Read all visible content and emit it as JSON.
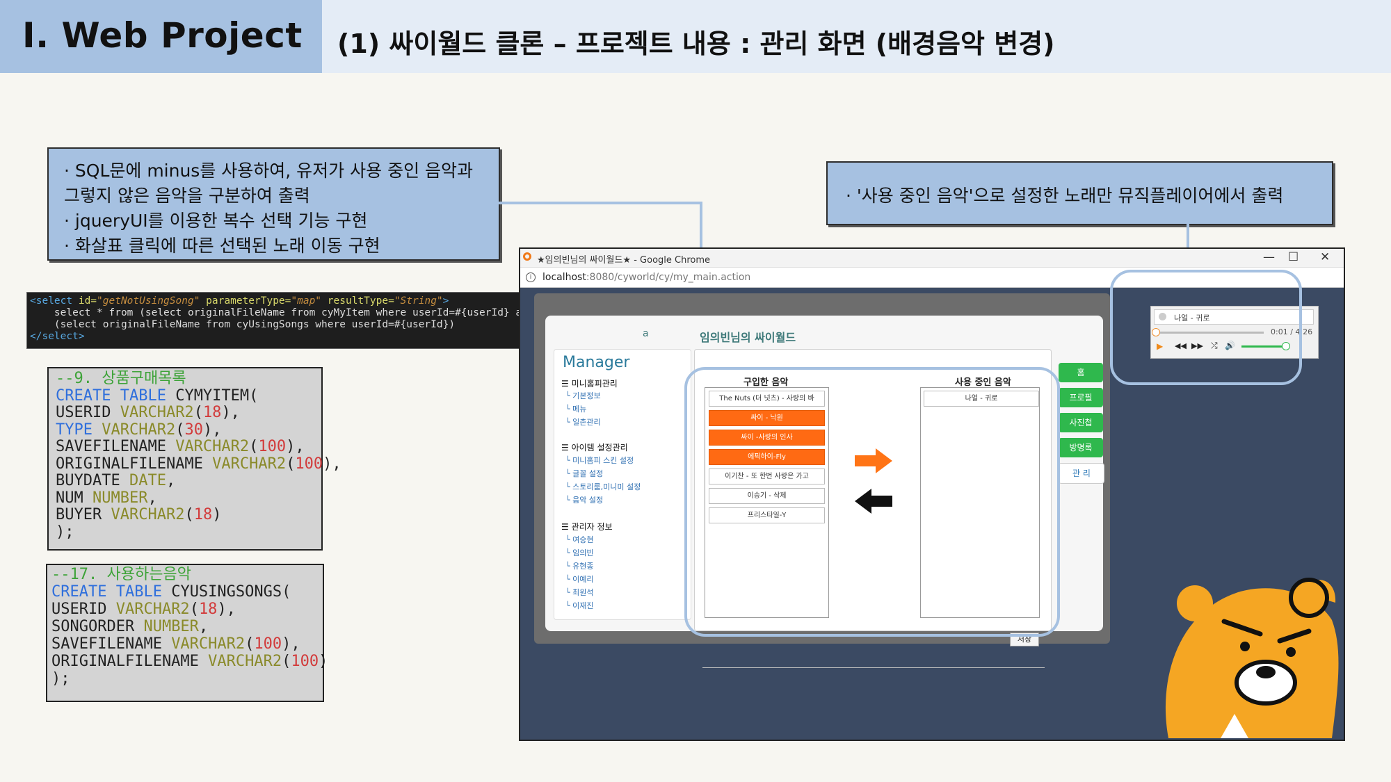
{
  "header": {
    "section": "Ⅰ. Web Project",
    "title": "(1) 싸이월드 클론 – 프로젝트 내용 : 관리 화면 (배경음악 변경)"
  },
  "notes": {
    "left": [
      "· SQL문에 minus를 사용하여, 유저가 사용 중인 음악과",
      "  그렇지 않은 음악을 구분하여 출력",
      "· jqueryUI를 이용한 복수 선택 기능 구현",
      "· 화살표 클릭에 따른 선택된 노래 이동 구현"
    ],
    "right": "· '사용 중인 음악'으로 설정한 노래만 뮤직플레이어에서 출력"
  },
  "sql_select": {
    "line1_tag_open": "<select",
    "line1_attr1": " id=",
    "line1_val1": "\"getNotUsingSong\"",
    "line1_attr2": " parameterType=",
    "line1_val2": "\"map\"",
    "line1_attr3": " resultType=",
    "line1_val3": "\"String\"",
    "line1_close": ">",
    "line2": "    select * from (select originalFileName from cyMyItem where userId=#{userId} and type = #{type}) minus",
    "line3": "    (select originalFileName from cyUsingSongs where userId=#{userId})",
    "line4": "</select>"
  },
  "code_cymyitem": {
    "comment": "--9. 상품구매목록",
    "create": "CREATE TABLE",
    "table": " CYMYITEM(",
    "cols": [
      {
        "name": "USERID ",
        "type": "VARCHAR2",
        "open": "(",
        "size": "18",
        "close": "),"
      },
      {
        "name": "TYPE ",
        "type": "VARCHAR2",
        "open": "(",
        "size": "30",
        "close": "),"
      },
      {
        "name": "SAVEFILENAME ",
        "type": "VARCHAR2",
        "open": "(",
        "size": "100",
        "close": "),"
      },
      {
        "name": "ORIGINALFILENAME ",
        "type": "VARCHAR2",
        "open": "(",
        "size": "100",
        "close": "),"
      },
      {
        "name": "BUYDATE ",
        "type": "DATE",
        "open": "",
        "size": "",
        "close": ","
      },
      {
        "name": "NUM ",
        "type": "NUMBER",
        "open": "",
        "size": "",
        "close": ","
      },
      {
        "name": "BUYER ",
        "type": "VARCHAR2",
        "open": "(",
        "size": "18",
        "close": ")"
      }
    ],
    "end": ");"
  },
  "code_cyusingsongs": {
    "comment": "--17. 사용하는음악",
    "create": "CREATE TABLE",
    "table": " CYUSINGSONGS(",
    "cols": [
      {
        "name": "USERID ",
        "type": "VARCHAR2",
        "open": "(",
        "size": "18",
        "close": "),"
      },
      {
        "name": "SONGORDER ",
        "type": "NUMBER",
        "open": "",
        "size": "",
        "close": ","
      },
      {
        "name": "SAVEFILENAME ",
        "type": "VARCHAR2",
        "open": "(",
        "size": "100",
        "close": "),"
      },
      {
        "name": "ORIGINALFILENAME ",
        "type": "VARCHAR2",
        "open": "(",
        "size": "100",
        "close": ")"
      }
    ],
    "end": ");"
  },
  "browser": {
    "title": "★임의빈님의 싸이월드★ - Google Chrome",
    "url_host": "localhost",
    "url_path": ":8080/cyworld/cy/my_main.action",
    "buttons": {
      "minimize": "—",
      "maximize": "☐",
      "close": "✕"
    }
  },
  "cy": {
    "page_title": "임의빈님의 싸이월드",
    "manager_title": "Manager",
    "menu": [
      {
        "heading": "미니홈피관리",
        "items": [
          "기본정보",
          "메뉴",
          "일촌관리"
        ]
      },
      {
        "heading": "아이템 설정관리",
        "items": [
          "미니홈피 스킨 설정",
          "글꼴 설정",
          "스토리룸,미니미 설정",
          "음악 설정"
        ]
      },
      {
        "heading": "관리자 정보",
        "items": [
          "여승현",
          "임의빈",
          "유현종",
          "이예리",
          "최원석",
          "이재진"
        ]
      }
    ],
    "purchased_label": "구입한 음악",
    "using_label": "사용 중인 음악",
    "purchased_songs": [
      {
        "title": "The Nuts (더 넛츠) - 사랑의 바",
        "selected": false
      },
      {
        "title": "싸이 - 낙원",
        "selected": true
      },
      {
        "title": "싸이 -사랑의 인사",
        "selected": true
      },
      {
        "title": "에픽하이-Fly",
        "selected": true
      },
      {
        "title": "이기찬 - 또 한번 사랑은 가고",
        "selected": false
      },
      {
        "title": "이승기 - 삭제",
        "selected": false
      },
      {
        "title": "프리스타일-Y",
        "selected": false
      }
    ],
    "using_songs": [
      "나얼 - 귀로"
    ],
    "save_button": "저장",
    "side_tabs": [
      "홈",
      "프로필",
      "사진첩",
      "방명록",
      "관 리"
    ],
    "colors": {
      "selected": "#ff6a13",
      "tab": "#2fb84d",
      "accent": "#a6c1e1"
    }
  },
  "player": {
    "song": "나얼 - 귀로",
    "time": "0:01 / 4:26"
  }
}
